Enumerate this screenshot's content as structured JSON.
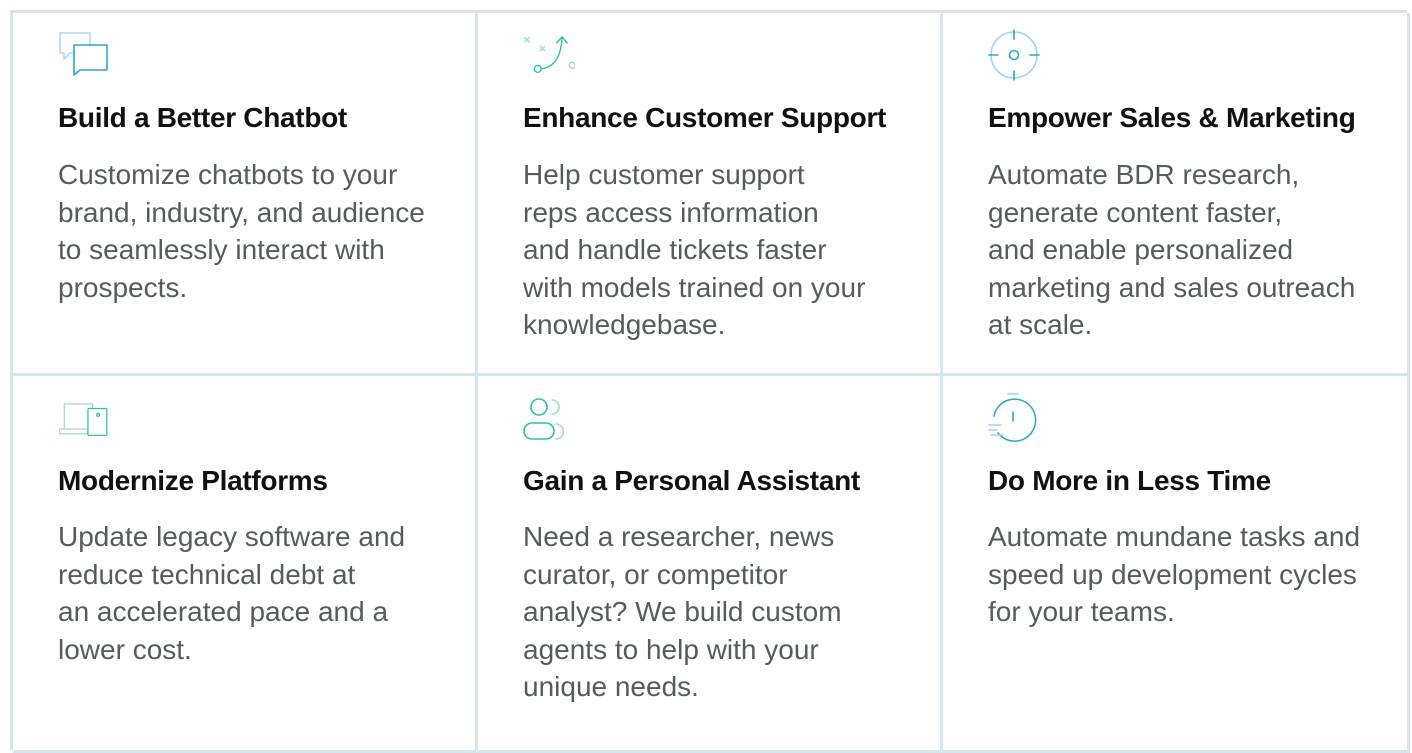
{
  "colors": {
    "border": "#d6e6ef",
    "heading": "#111111",
    "body_text": "#555b5f",
    "icon_cyan": "#3fb3d9",
    "icon_teal": "#2cc3a0"
  },
  "cards": [
    {
      "icon": "chat-bubbles-icon",
      "title": "Build a Better Chatbot",
      "description": "Customize chatbots to your\nbrand, industry, and audience\nto seamlessly interact with\nprospects."
    },
    {
      "icon": "strategy-play-icon",
      "title": "Enhance Customer Support",
      "description": "Help customer support\nreps access information\nand handle tickets faster\nwith models trained on your\nknowledgebase."
    },
    {
      "icon": "target-crosshair-icon",
      "title": "Empower Sales & Marketing",
      "description": "Automate BDR research,\ngenerate content faster,\nand enable personalized\nmarketing and sales outreach\nat scale."
    },
    {
      "icon": "devices-icon",
      "title": "Modernize Platforms",
      "description": "Update legacy software and\nreduce technical debt at\nan accelerated pace and a\nlower cost."
    },
    {
      "icon": "person-assistant-icon",
      "title": "Gain a Personal Assistant",
      "description": "Need a researcher, news\ncurator, or competitor\nanalyst? We build custom\nagents to help with your\nunique needs."
    },
    {
      "icon": "stopwatch-icon",
      "title": "Do More in Less Time",
      "description": "Automate mundane tasks and\nspeed up development cycles\nfor your teams."
    }
  ]
}
